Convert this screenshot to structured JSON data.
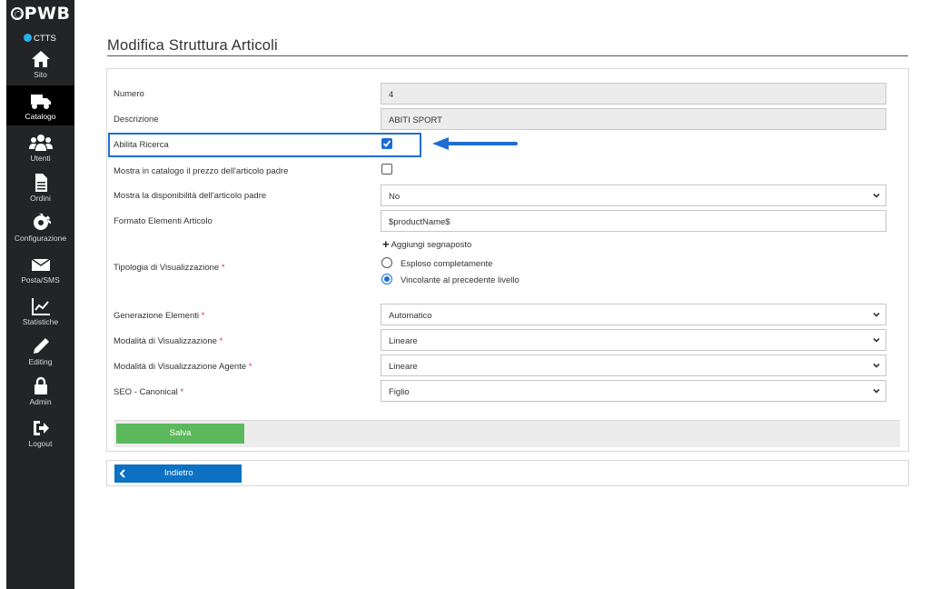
{
  "sidebar": {
    "logo": "PWB",
    "site": "CTTS",
    "items": [
      {
        "label": "Sito",
        "icon": "home-icon"
      },
      {
        "label": "Catalogo",
        "icon": "truck-icon"
      },
      {
        "label": "Utenti",
        "icon": "users-icon"
      },
      {
        "label": "Ordini",
        "icon": "document-icon"
      },
      {
        "label": "Configurazione",
        "icon": "gear-icon"
      },
      {
        "label": "Posta/SMS",
        "icon": "envelope-icon"
      },
      {
        "label": "Statistiche",
        "icon": "chart-icon"
      },
      {
        "label": "Editing",
        "icon": "pencil-icon"
      },
      {
        "label": "Admin",
        "icon": "lock-icon"
      },
      {
        "label": "Logout",
        "icon": "logout-icon"
      }
    ],
    "active": "Catalogo"
  },
  "page": {
    "title": "Modifica Struttura Articoli"
  },
  "form": {
    "numero": {
      "label": "Numero",
      "value": "4"
    },
    "descrizione": {
      "label": "Descrizione",
      "value": "ABITI SPORT"
    },
    "abilita_ricerca": {
      "label": "Abilita Ricerca",
      "checked": true
    },
    "mostra_prezzo_padre": {
      "label": "Mostra in catalogo il prezzo dell'articolo padre",
      "checked": false
    },
    "mostra_disponibilita": {
      "label": "Mostra la disponibilità dell'articolo padre",
      "value": "No"
    },
    "formato_elementi": {
      "label": "Formato Elementi Articolo",
      "value": "$productName$",
      "add_placeholder": "Aggiungi segnaposto"
    },
    "tipologia": {
      "label": "Tipologia di Visualizzazione",
      "required_mark": "*",
      "options": [
        "Esploso completamente",
        "Vincolante al precedente livello"
      ],
      "selected": "Vincolante al precedente livello"
    },
    "generazione": {
      "label": "Generazione Elementi",
      "required_mark": "*",
      "value": "Automatico"
    },
    "modalita": {
      "label": "Modalità di Visualizzazione",
      "required_mark": "*",
      "value": "Lineare"
    },
    "modalita_agente": {
      "label": "Modalità di Visualizzazione Agente",
      "required_mark": "*",
      "value": "Lineare"
    },
    "seo": {
      "label": "SEO - Canonical",
      "required_mark": "*",
      "value": "Figlio"
    }
  },
  "actions": {
    "save_label": "Salva",
    "back_label": "Indietro"
  },
  "colors": {
    "highlight": "#1f6fd1",
    "save": "#5cb85c",
    "back": "#0c71c3",
    "sidebar": "#222426"
  }
}
